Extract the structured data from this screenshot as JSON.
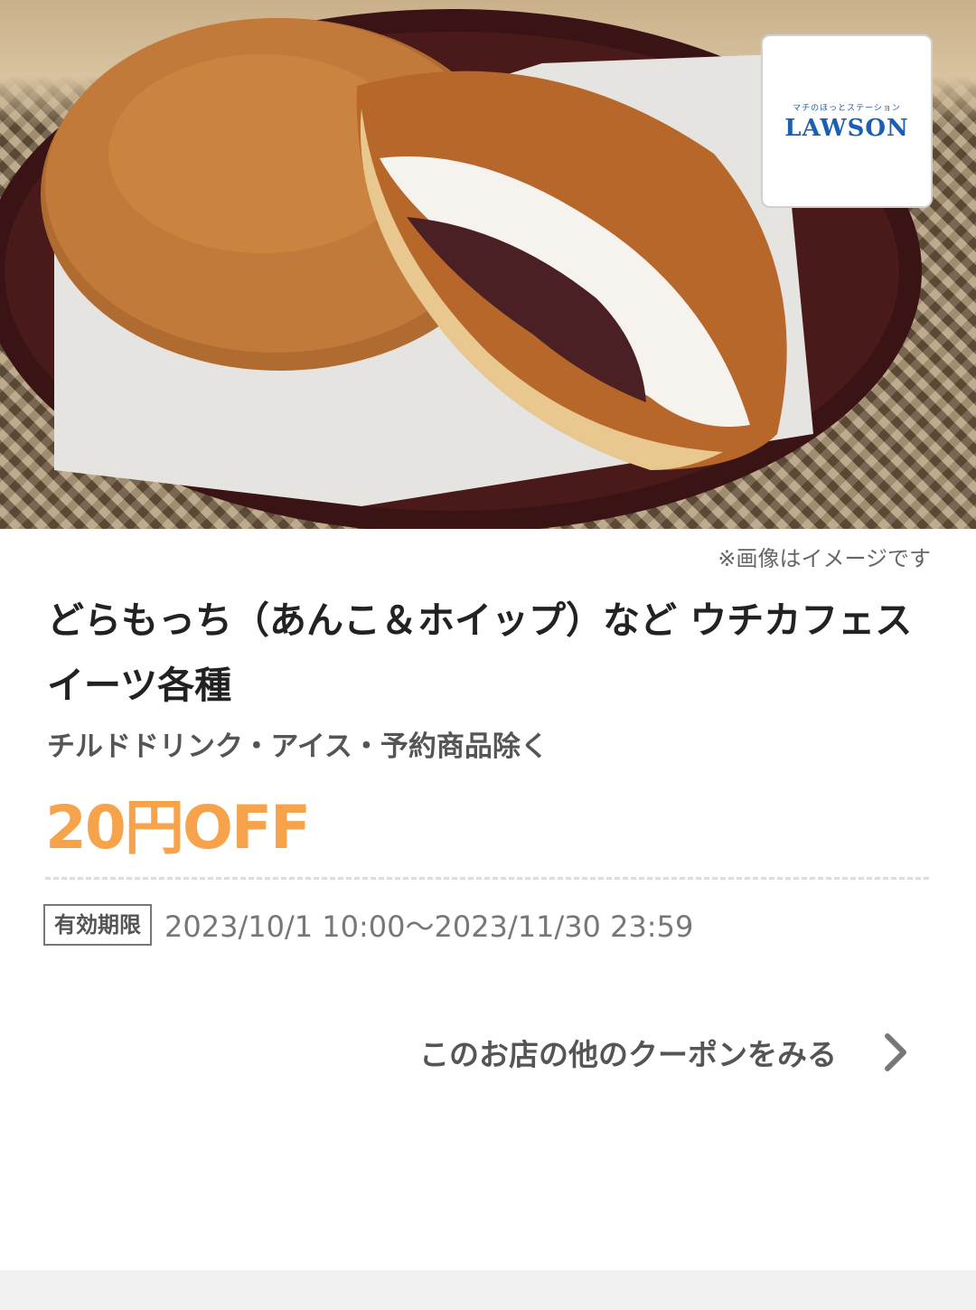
{
  "hero": {
    "image_alt": "dorayaki product photo",
    "image_note": "※画像はイメージです"
  },
  "store": {
    "logo_tagline": "マチのほっとステーション",
    "logo_name": "LAWSON"
  },
  "coupon": {
    "title": "どらもっち（あんこ＆ホイップ）など ウチカフェスイーツ各種",
    "exclusions": "チルドドリンク・アイス・予約商品除く",
    "discount": "20円OFF",
    "validity_label": "有効期限",
    "validity_dates": "2023/10/1 10:00〜2023/11/30 23:59"
  },
  "actions": {
    "more_coupons": "このお店の他のクーポンをみる"
  },
  "colors": {
    "discount": "#f7a34b",
    "brand_blue": "#1a5fb4"
  },
  "icons": {
    "more": "chevron-right-icon"
  }
}
